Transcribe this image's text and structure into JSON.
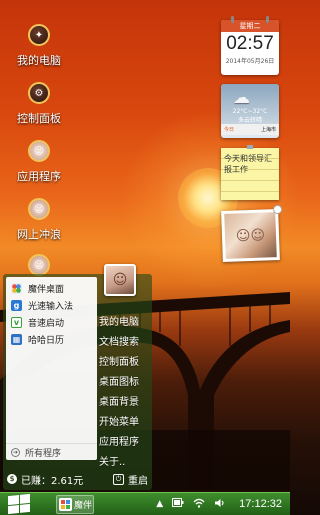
{
  "desktop_icons": [
    {
      "label": "我的电脑"
    },
    {
      "label": "控制面板"
    },
    {
      "label": "应用程序"
    },
    {
      "label": "网上冲浪"
    },
    {
      "label": ""
    }
  ],
  "clock_widget": {
    "weekday": "星期二",
    "time": "02:57",
    "date": "2014年05月26日"
  },
  "weather_widget": {
    "temp": "22°C~32°C",
    "condition": "多云转晴",
    "day": "今日",
    "city": "上海市"
  },
  "note_widget": {
    "text": "今天和领导汇报工作"
  },
  "start_menu": {
    "apps": [
      {
        "label": "魔伴桌面",
        "icon_color": "#3d8ee6"
      },
      {
        "label": "光速输入法",
        "icon_color": "#2a7ad4"
      },
      {
        "label": "音速启动",
        "icon_color": "#36a23a"
      },
      {
        "label": "哈哈日历",
        "icon_color": "#2f6fc4"
      }
    ],
    "all_programs": "所有程序",
    "right_links": [
      "我的电脑",
      "文档搜索",
      "控制面板",
      "桌面图标",
      "桌面背景",
      "开始菜单",
      "应用程序",
      "关于.."
    ],
    "earned": "已赚：2.61元",
    "restart": "重启"
  },
  "taskbar": {
    "task_label": "魔伴",
    "time": "17:12:32",
    "tray_icons": [
      "arrow-up-icon",
      "battery-icon",
      "wifi-icon",
      "volume-icon"
    ]
  }
}
